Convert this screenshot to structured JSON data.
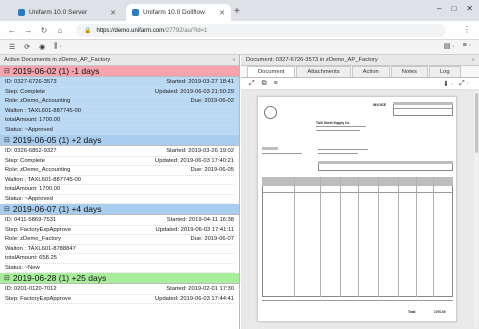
{
  "browser": {
    "tabs": [
      {
        "label": "Unifarm 10.0 Server",
        "active": false
      },
      {
        "label": "Unifarm 10.0 Dollflow",
        "active": true
      }
    ],
    "new_tab": "+",
    "window_controls": {
      "minimize": "–",
      "maximize": "□",
      "close": "✕"
    },
    "nav": {
      "back": "←",
      "forward": "→",
      "reload": "↻",
      "home": "⌂"
    },
    "address": {
      "lock": "🔒",
      "host": "https://demo.unifarm.com",
      "path": "/27792/au/?id=1"
    },
    "menu": "⋮"
  },
  "toolbar": {
    "icons": [
      "☰",
      "⟳",
      "◉",
      "⫼ ·"
    ],
    "right_icons": [
      "▤ ·",
      "≡ ·"
    ]
  },
  "left_panel": {
    "title": "Active Documents in zDemo_AP_Factory",
    "collapse_icon": "‹",
    "groups": [
      {
        "label": "2019-06-02 (1) -1 days",
        "color": "red",
        "card": {
          "selected": true,
          "rows": [
            {
              "left": "ID: 0327-6726-3573",
              "right": "Started: 2019-03-27 18:41"
            },
            {
              "left": "Step: Complete",
              "right": "Updated: 2019-06-03 21:50:29"
            },
            {
              "left": "Role: zDemo_Accounting",
              "right": "Due: 2019-06-02"
            },
            {
              "left": "Walton : TAXL601-887745-00",
              "right": ""
            },
            {
              "left": "totalAmount: 1700.00",
              "right": ""
            },
            {
              "left": "Status: ~Approved",
              "right": ""
            }
          ]
        }
      },
      {
        "label": "2019-06-05 (1) +2 days",
        "color": "blue",
        "card": {
          "selected": false,
          "rows": [
            {
              "left": "ID: 0326-6852-9327",
              "right": "Started: 2019-03-26 19:02"
            },
            {
              "left": "Step: Complete",
              "right": "Updated: 2019-06-03 17:40:21"
            },
            {
              "left": "Role: zDemo_Accounting",
              "right": "Due: 2019-06-05"
            },
            {
              "left": "Walton : TAXL601-887745-00",
              "right": ""
            },
            {
              "left": "totalAmount: 1700.00",
              "right": ""
            },
            {
              "left": "Status: ~Approved",
              "right": ""
            }
          ]
        }
      },
      {
        "label": "2019-06-07 (1) +4 days",
        "color": "blue",
        "card": {
          "selected": false,
          "rows": [
            {
              "left": "ID: 0411-5869-7531",
              "right": "Started: 2019-04-11 16:38"
            },
            {
              "left": "Step: FactoryExpApprove",
              "right": "Updated: 2019-06-03 17:41:11"
            },
            {
              "left": "Role: zDemo_Factory",
              "right": "Due: 2019-06-07"
            },
            {
              "left": "Walton : TAXL601-8788847",
              "right": ""
            },
            {
              "left": "totalAmount: 658.25",
              "right": ""
            },
            {
              "left": "Status: ~New",
              "right": ""
            }
          ]
        }
      },
      {
        "label": "2019-06-28 (1) +25 days",
        "color": "green",
        "card": {
          "selected": false,
          "rows": [
            {
              "left": "ID: 0201-0120-7012",
              "right": "Started: 2019-02-01 17:30"
            },
            {
              "left": "Step: FactoryExpApprove",
              "right": "Updated: 2019-06-03 17:44:41"
            }
          ]
        }
      }
    ]
  },
  "right_panel": {
    "title": "Document: 0327-6726-3573 in zDemo_AP_Factory",
    "expand_icon": "›",
    "tabs": [
      "Document",
      "Attachments",
      "Action",
      "Notes",
      "Log"
    ],
    "active_tab": "Document",
    "tools": [
      "⤢",
      "⧉",
      "≡"
    ],
    "tools_right": [
      "⬇ ·",
      "⤢ ·"
    ],
    "doc_preview": {
      "heading": "INVOICE",
      "vendor": "TAXI Sheet Supply Co.",
      "subtotal_label": "Total",
      "total_value": "1700.00"
    }
  }
}
